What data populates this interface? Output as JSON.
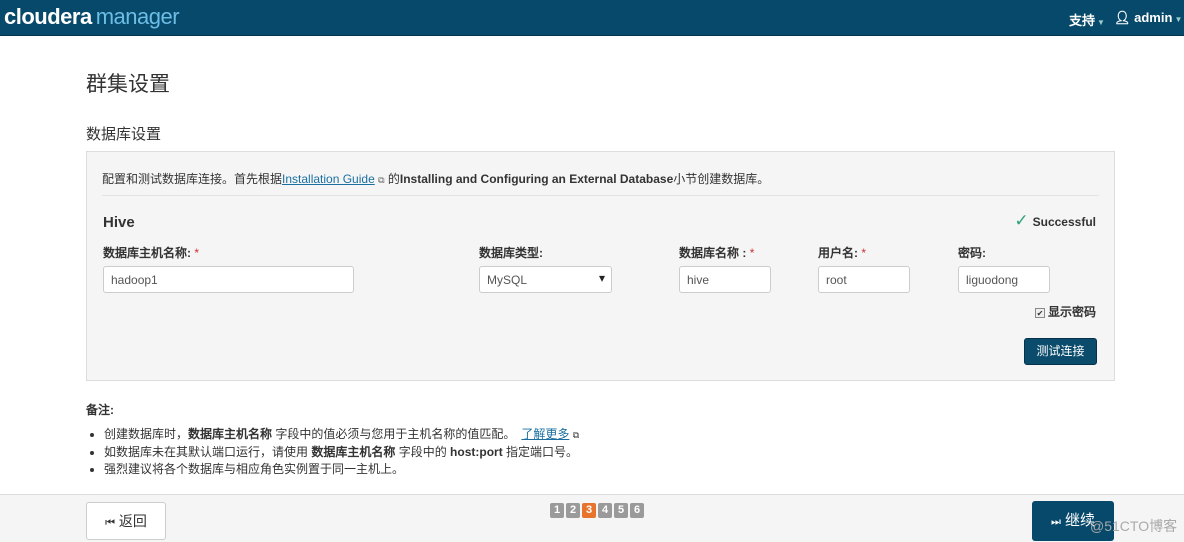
{
  "nav": {
    "logo_a": "cloudera",
    "logo_b": "manager",
    "support": "支持",
    "user": "admin"
  },
  "page_title": "群集设置",
  "section_title": "数据库设置",
  "intro": {
    "pre": "配置和测试数据库连接。首先根据",
    "link": "Installation Guide",
    "mid": " 的",
    "bold": "Installing and Configuring an External Database",
    "post": "小节创建数据库。"
  },
  "service": {
    "name": "Hive",
    "status": "Successful",
    "fields": {
      "host_label": "数据库主机名称:",
      "host_value": "hadoop1",
      "type_label": "数据库类型:",
      "type_value": "MySQL",
      "dbname_label": "数据库名称 :",
      "dbname_value": "hive",
      "user_label": "用户名:",
      "user_value": "root",
      "pw_label": "密码:",
      "pw_value": "liguodong"
    },
    "show_password": "显示密码",
    "show_password_checked": true,
    "test_button": "测试连接"
  },
  "notes": {
    "title": "备注:",
    "n1_pre": "创建数据库时，",
    "n1_bold": "数据库主机名称",
    "n1_post": " 字段中的值必须与您用于主机名称的值匹配。",
    "n1_link": "了解更多",
    "n2_pre": "如数据库未在其默认端口运行，请使用 ",
    "n2_bold": "数据库主机名称",
    "n2_mid": " 字段中的 ",
    "n2_bold2": "host:port",
    "n2_post": " 指定端口号。",
    "n3": "强烈建议将各个数据库与相应角色实例置于同一主机上。"
  },
  "footer": {
    "back": "返回",
    "continue": "继续",
    "pages": [
      "1",
      "2",
      "3",
      "4",
      "5",
      "6"
    ],
    "current_page": 3
  },
  "watermark": "@51CTO博客"
}
